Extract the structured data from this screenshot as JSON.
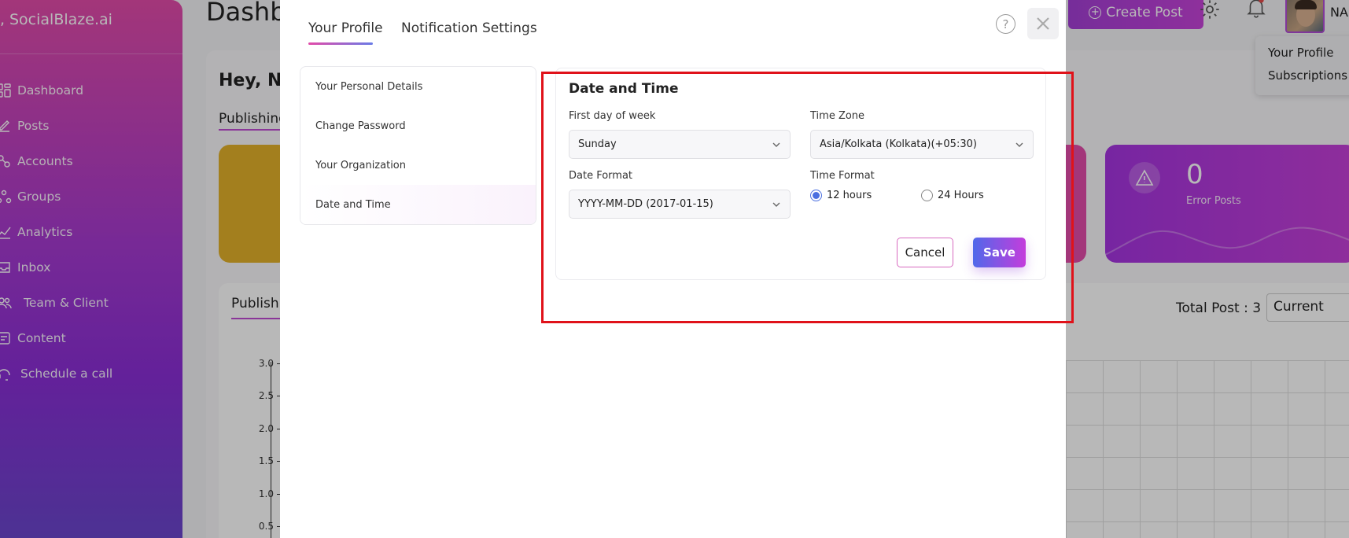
{
  "app": {
    "brand": "SocialBlaze.ai",
    "page_title": "Dashb",
    "greeting": "Hey, NA",
    "publishing_tab": "Publishing",
    "publishing_tab2": "Publishi",
    "total_post": "Total Post : 3",
    "period_select": "Current",
    "create_post": "Create Post",
    "username": "NA",
    "error_posts": {
      "value": "0",
      "label": "Error Posts"
    }
  },
  "sidebar": {
    "items": [
      {
        "label": "Dashboard",
        "icon": "grid-icon"
      },
      {
        "label": "Posts",
        "icon": "edit-icon"
      },
      {
        "label": "Accounts",
        "icon": "accounts-icon"
      },
      {
        "label": "Groups",
        "icon": "groups-icon"
      },
      {
        "label": "Analytics",
        "icon": "analytics-icon"
      },
      {
        "label": "Inbox",
        "icon": "inbox-icon"
      },
      {
        "label": "Team & Client",
        "icon": "team-icon"
      },
      {
        "label": "Content",
        "icon": "content-icon"
      },
      {
        "label": "Schedule a call",
        "icon": "headset-icon"
      }
    ]
  },
  "profile_menu": {
    "items": [
      "Your Profile",
      "Subscriptions"
    ]
  },
  "chart_axis": {
    "ticks": [
      "3.0",
      "2.5",
      "2.0",
      "1.5",
      "1.0",
      "0.5"
    ]
  },
  "modal": {
    "tabs": [
      "Your Profile",
      "Notification Settings"
    ],
    "menu": [
      "Your Personal Details",
      "Change Password",
      "Your Organization",
      "Date and Time"
    ],
    "section_title": "Date and Time",
    "first_day_label": "First day of week",
    "first_day_value": "Sunday",
    "timezone_label": "Time Zone",
    "timezone_value": "Asia/Kolkata (Kolkata)(+05:30)",
    "date_format_label": "Date Format",
    "date_format_value": "YYYY-MM-DD (2017-01-15)",
    "time_format_label": "Time Format",
    "time_format_options": [
      "12 hours",
      "24 Hours"
    ],
    "time_format_selected": "12 hours",
    "cancel_label": "Cancel",
    "save_label": "Save"
  },
  "colors": {
    "brand_gradient_start": "#e24ba9",
    "brand_gradient_end": "#6a46cc",
    "highlight_border": "#e0121a",
    "radio_active": "#4a6fe0"
  }
}
